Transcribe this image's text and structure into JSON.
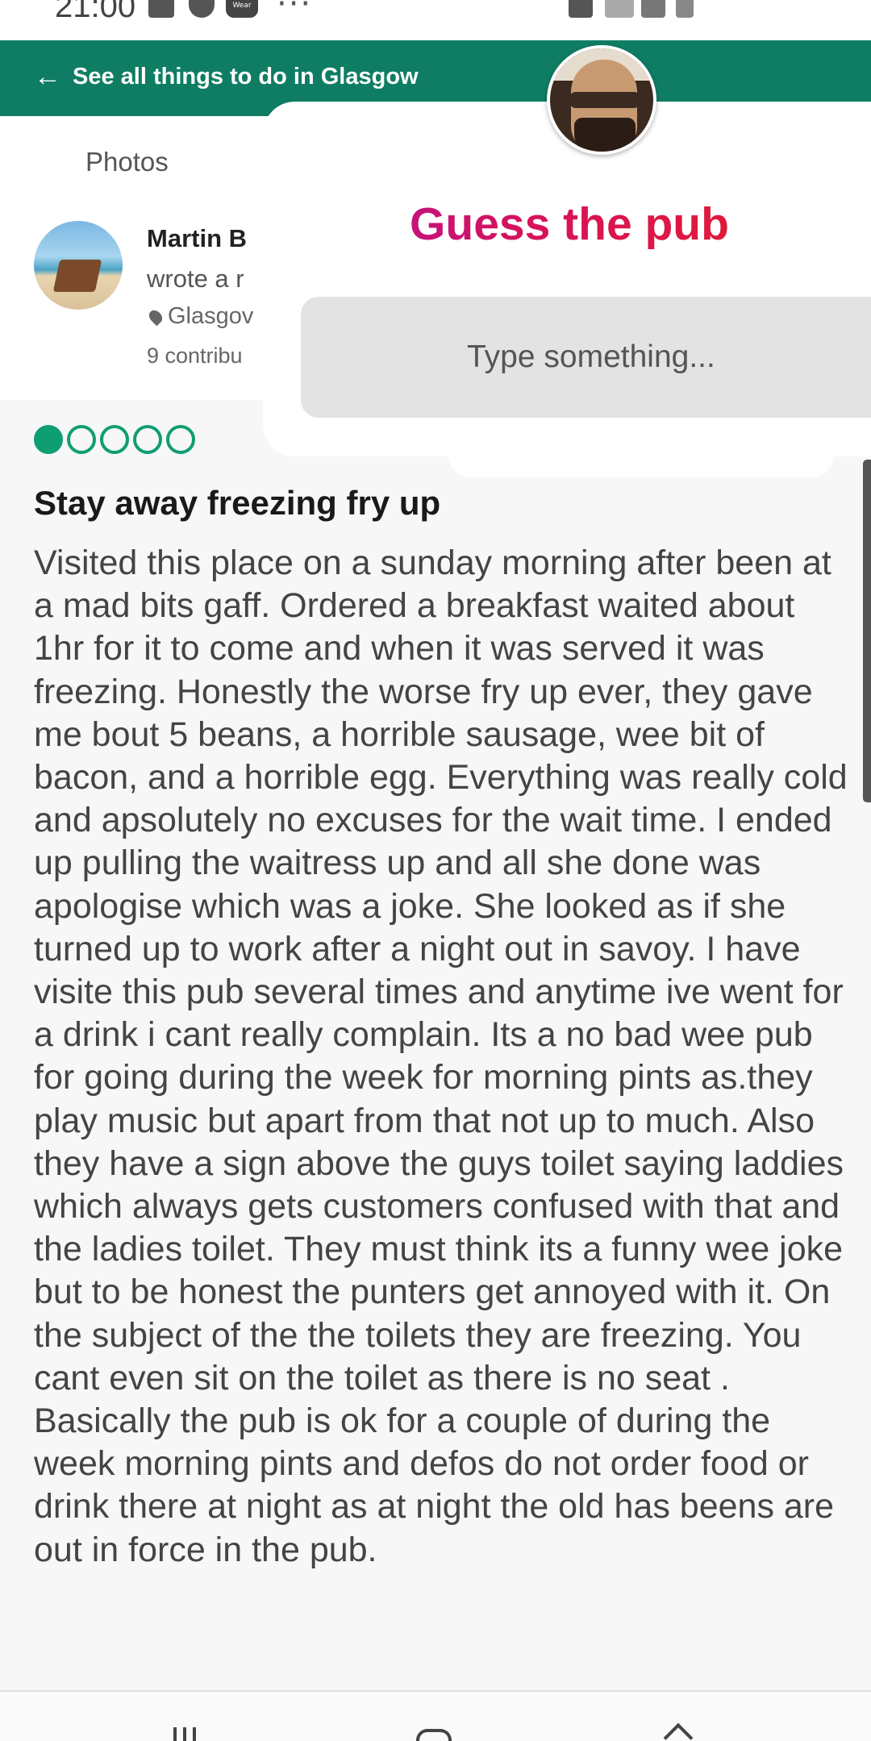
{
  "status_bar": {
    "time": "21:00",
    "icons": [
      "gallery-icon",
      "circle-icon",
      "wear-icon",
      "more-icon",
      "mute-icon",
      "wifi-icon",
      "signal-icon",
      "battery-icon"
    ],
    "wear_label": "Wear",
    "more": "···"
  },
  "header": {
    "back_arrow": "←",
    "back_label": "See all things to do in Glasgow",
    "color": "#0f7d63"
  },
  "tabs": {
    "photos": "Photos"
  },
  "reviewer": {
    "name": "Martin B",
    "action": "wrote a r",
    "location": "Glasgov",
    "contributions": "9 contribu"
  },
  "review": {
    "rating": 1,
    "rating_max": 5,
    "rating_color": "#0f9e73",
    "title": "Stay away freezing fry up",
    "body": "Visited this place on a sunday morning after been at a mad bits gaff. Ordered a breakfast waited about 1hr for it to come and when it was served it was freezing. Honestly the worse fry up ever, they gave me bout 5 beans, a horrible sausage, wee bit of bacon, and a horrible egg. Everything was really cold and apsolutely no excuses for the wait time. I ended up pulling the waitress up and all she done was apologise which was a joke. She looked as if she turned up to work after a night out in savoy. I have visite this pub several times and anytime ive went for a drink i cant really complain. Its a no bad wee pub for going during the week for morning pints as.they play music but apart from that not up to much. Also they have a sign above the guys toilet saying laddies which always gets customers confused with that and the ladies toilet. They must think its a funny wee joke but to be honest the punters get annoyed with it. On the subject of the the toilets they are freezing. You cant even sit on the toilet as there is no seat . Basically the pub is ok for a couple of during the week morning pints and defos do not order food or drink there at night as at night the old has beens are out in force in the pub."
  },
  "overlay": {
    "title": "Guess the pub",
    "input_placeholder": "Type something...",
    "title_gradient": [
      "#b0149e",
      "#d8125a",
      "#e32121"
    ]
  },
  "nav": {
    "icons": [
      "recent-apps-icon",
      "home-icon",
      "back-icon"
    ]
  }
}
